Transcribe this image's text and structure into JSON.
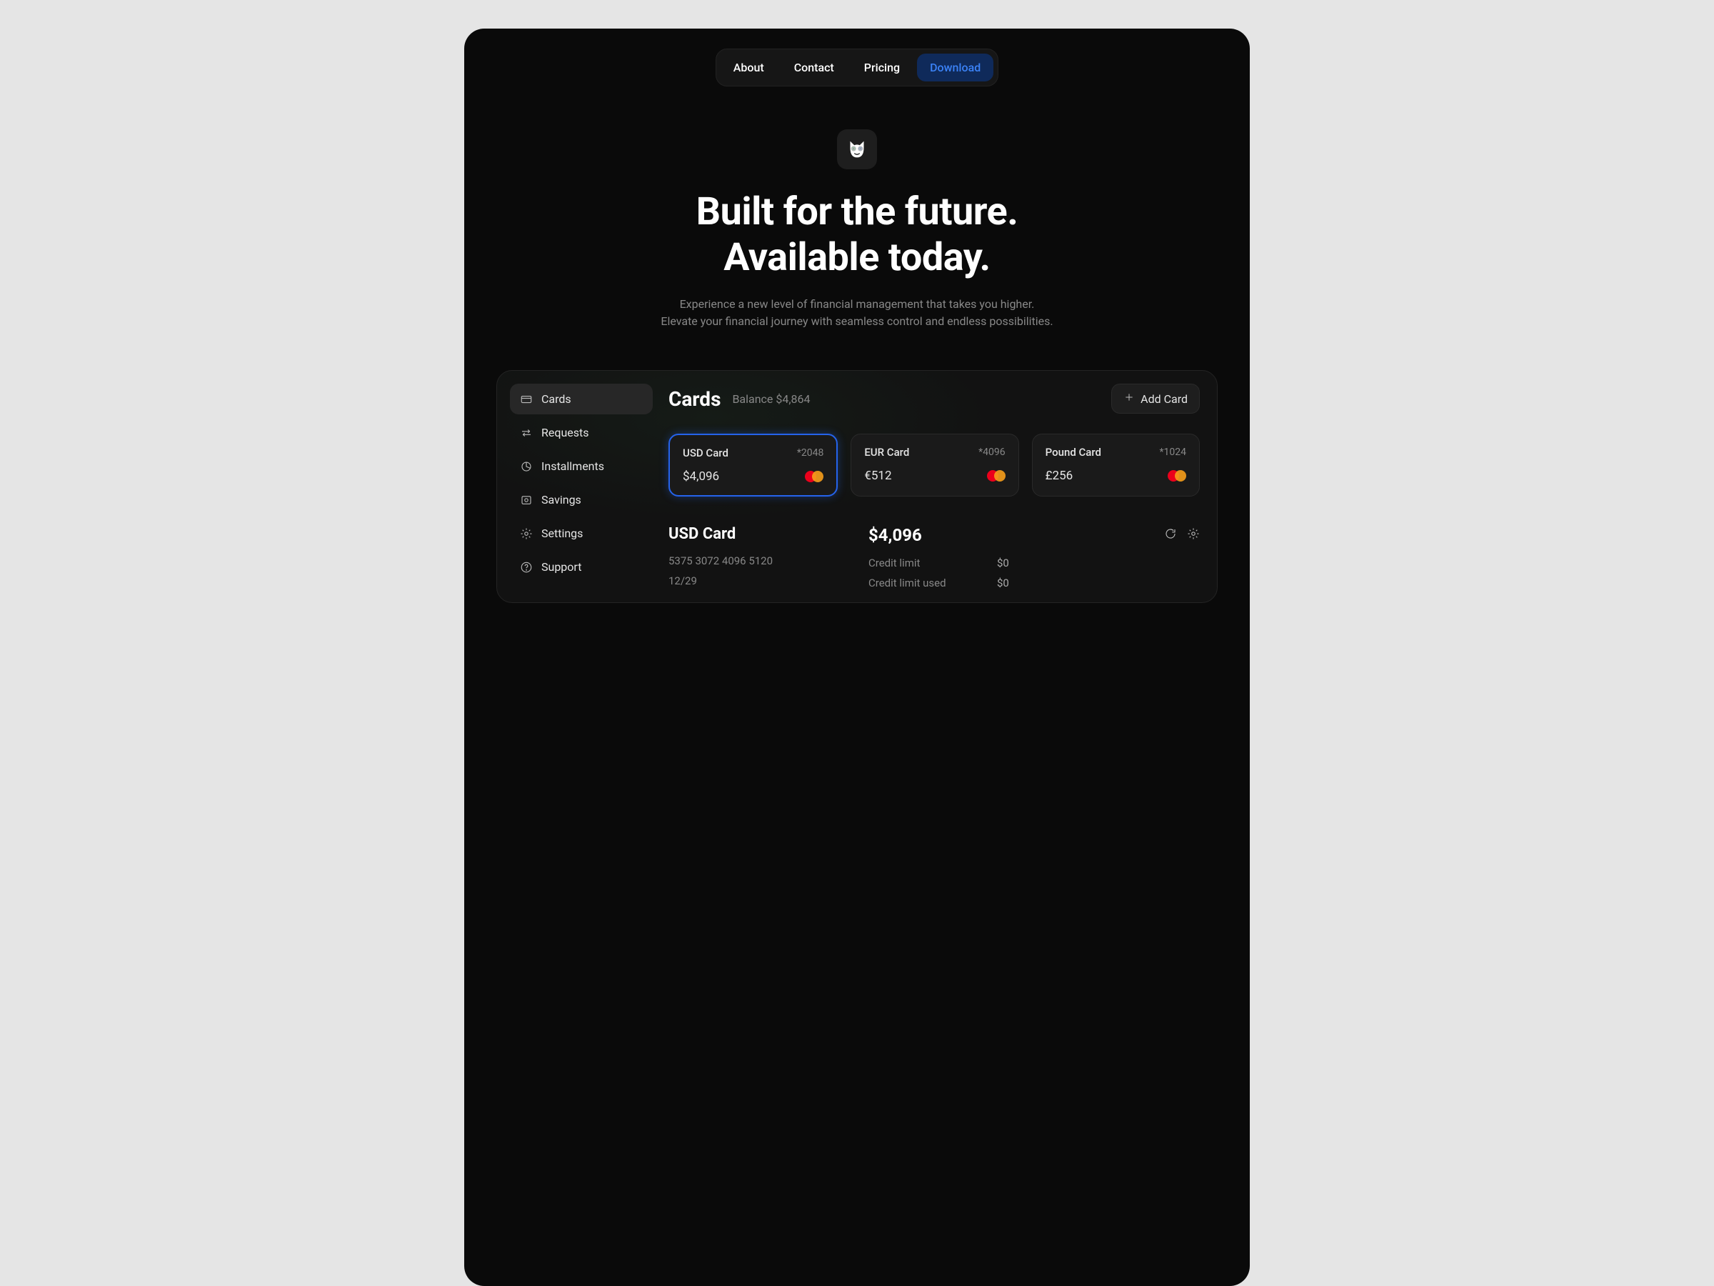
{
  "nav": {
    "items": [
      "About",
      "Contact",
      "Pricing",
      "Download"
    ],
    "active_index": 3
  },
  "hero": {
    "title_line1": "Built for the future.",
    "title_line2": "Available today.",
    "sub_line1": "Experience a new level of financial management that takes you higher.",
    "sub_line2": "Elevate your financial journey with seamless control and endless possibilities."
  },
  "sidebar": {
    "items": [
      {
        "label": "Cards",
        "icon": "card-icon"
      },
      {
        "label": "Requests",
        "icon": "transfer-icon"
      },
      {
        "label": "Installments",
        "icon": "pie-icon"
      },
      {
        "label": "Savings",
        "icon": "safe-icon"
      },
      {
        "label": "Settings",
        "icon": "gear-icon"
      },
      {
        "label": "Support",
        "icon": "help-icon"
      }
    ],
    "active_index": 0
  },
  "main": {
    "title": "Cards",
    "balance_label": "Balance $4,864",
    "add_card_label": "Add Card",
    "cards": [
      {
        "name": "USD Card",
        "masked": "*2048",
        "amount": "$4,096",
        "selected": true
      },
      {
        "name": "EUR Card",
        "masked": "*4096",
        "amount": "€512",
        "selected": false
      },
      {
        "name": "Pound Card",
        "masked": "*1024",
        "amount": "£256",
        "selected": false
      }
    ],
    "detail": {
      "name": "USD Card",
      "number": "5375 3072 4096 5120",
      "expiry": "12/29",
      "amount": "$4,096",
      "rows": [
        {
          "label": "Credit limit",
          "value": "$0"
        },
        {
          "label": "Credit limit used",
          "value": "$0"
        }
      ]
    }
  }
}
